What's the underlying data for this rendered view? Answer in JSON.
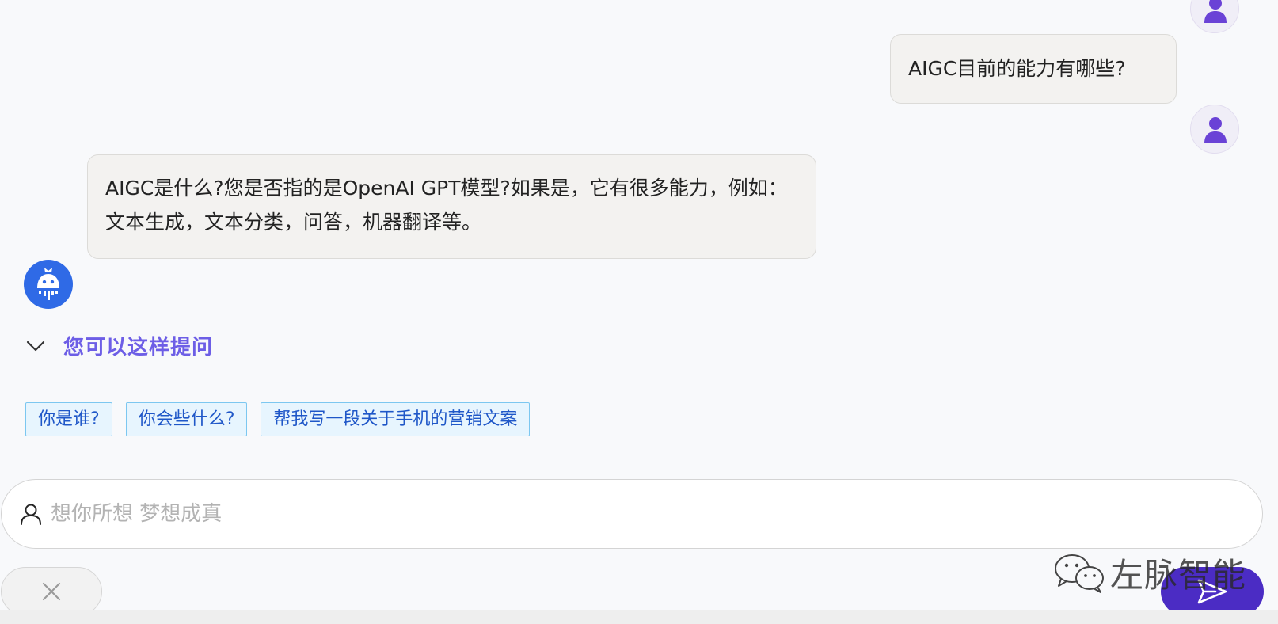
{
  "conversation": {
    "user_message": "AIGC目前的能力有哪些?",
    "bot_message": "AIGC是什么?您是否指的是OpenAI GPT模型?如果是，它有很多能力，例如：文本生成，文本分类，问答，机器翻译等。"
  },
  "suggestions": {
    "title": "您可以这样提问",
    "items": [
      {
        "label": "你是谁?"
      },
      {
        "label": "你会些什么?"
      },
      {
        "label": "帮我写一段关于手机的营销文案"
      }
    ]
  },
  "input": {
    "placeholder": "想你所想 梦想成真",
    "value": ""
  },
  "buttons": {
    "close_label": "X"
  },
  "watermark": {
    "text": "左脉智能"
  },
  "colors": {
    "accent": "#4b2cc4",
    "suggestion_title": "#6d5ee6",
    "bot_avatar": "#2f6ae6",
    "user_avatar_figure": "#6a42d6",
    "chip_border": "#7cc7f0",
    "chip_text": "#1f57c8"
  },
  "icons": {
    "user_avatar": "user-icon",
    "bot_avatar": "robot-icon",
    "collapse": "chevron-down-icon",
    "input_prefix": "person-outline-icon",
    "close": "close-icon",
    "send": "send-icon",
    "watermark": "wechat-icon"
  }
}
